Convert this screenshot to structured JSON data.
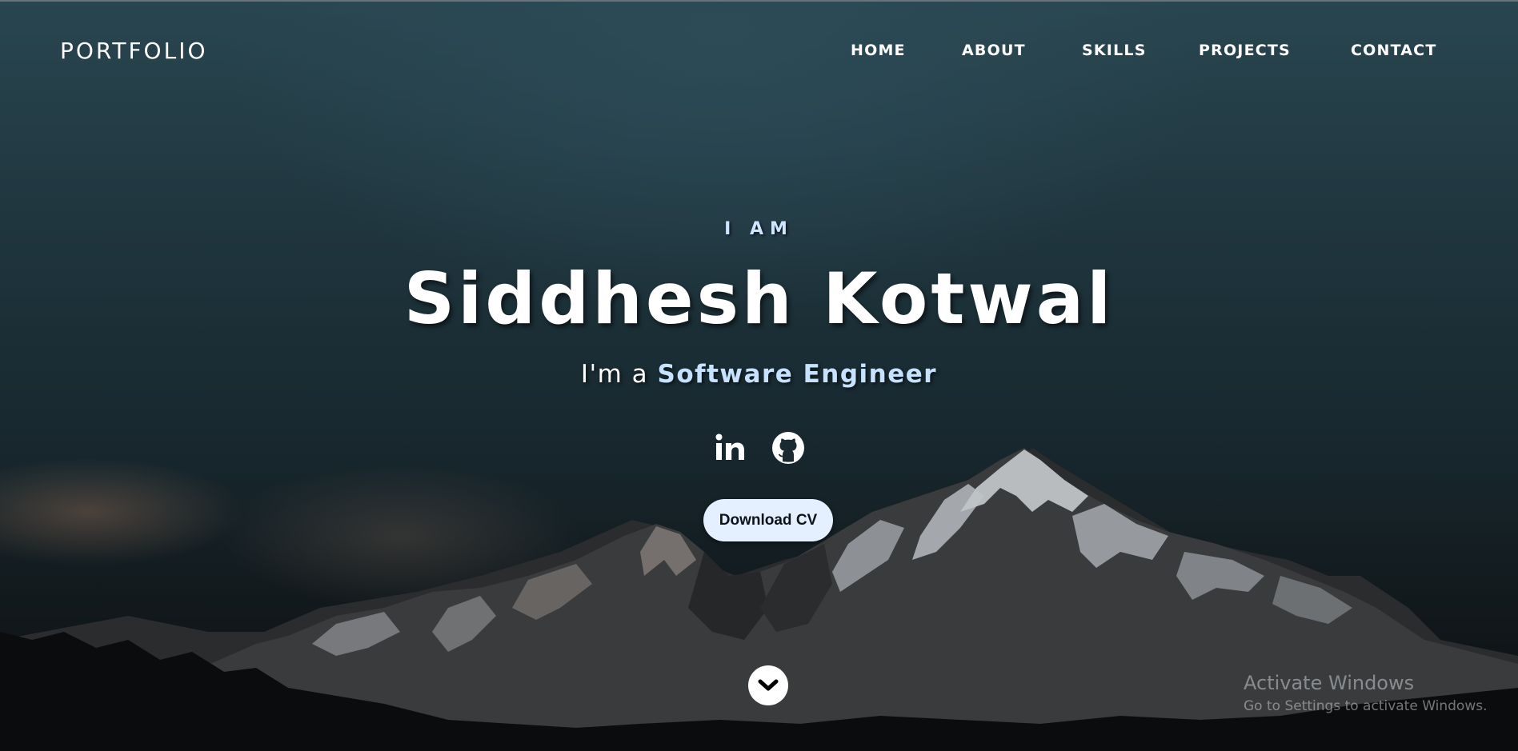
{
  "nav": {
    "logo": "PORTFOLIO",
    "items": [
      {
        "label": "HOME"
      },
      {
        "label": "ABOUT"
      },
      {
        "label": "SKILLS"
      },
      {
        "label": "PROJECTS"
      },
      {
        "label": "CONTACT"
      }
    ]
  },
  "hero": {
    "intro": "I AM",
    "name": "Siddhesh Kotwal",
    "role_prefix": "I'm a ",
    "role": "Software Engineer",
    "socials": [
      {
        "icon": "linkedin-icon"
      },
      {
        "icon": "github-icon"
      }
    ],
    "cta_label": "Download CV",
    "scroll_icon": "chevron-down-icon"
  },
  "watermark": {
    "title": "Activate Windows",
    "subtitle": "Go to Settings to activate Windows."
  },
  "colors": {
    "accent": "#c6e2ff",
    "button_bg": "#e4efff",
    "text": "#ffffff"
  }
}
